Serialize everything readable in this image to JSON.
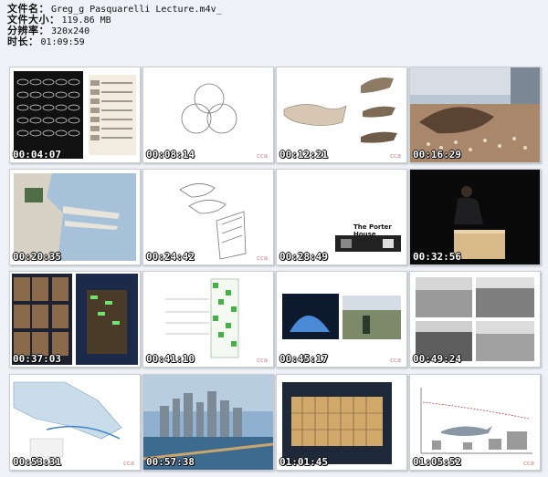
{
  "info": {
    "filename_label": "文件名：",
    "filename_value": "Greg_g Pasquarelli Lecture.m4v_",
    "filesize_label": "文件大小：",
    "filesize_value": "119.86 MB",
    "resolution_label": "分辨率：",
    "resolution_value": "320x240",
    "duration_label": "时长：",
    "duration_value": "01:09:59"
  },
  "brand_mark": "cca",
  "thumbnails": [
    {
      "timestamp": "00:04:07"
    },
    {
      "timestamp": "00:08:14"
    },
    {
      "timestamp": "00:12:21"
    },
    {
      "timestamp": "00:16:29"
    },
    {
      "timestamp": "00:20:35"
    },
    {
      "timestamp": "00:24:42"
    },
    {
      "timestamp": "00:28:49"
    },
    {
      "timestamp": "00:32:56"
    },
    {
      "timestamp": "00:37:03"
    },
    {
      "timestamp": "00:41:10"
    },
    {
      "timestamp": "00:45:17"
    },
    {
      "timestamp": "00:49:24"
    },
    {
      "timestamp": "00:53:31"
    },
    {
      "timestamp": "00:57:38"
    },
    {
      "timestamp": "01:01:45"
    },
    {
      "timestamp": "01:05:52"
    }
  ],
  "slides": {
    "porter_house_title": "The Porter House"
  }
}
